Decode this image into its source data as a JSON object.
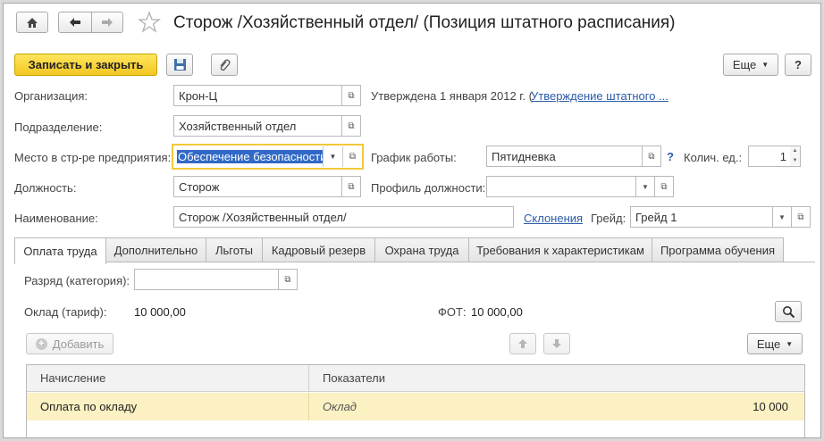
{
  "window": {
    "title": "Сторож /Хозяйственный отдел/ (Позиция штатного расписания)"
  },
  "toolbar": {
    "save_close_label": "Записать и закрыть",
    "more_label": "Еще",
    "help_label": "?"
  },
  "form": {
    "org_label": "Организация:",
    "org_value": "Крон-Ц",
    "approved_text": "Утверждена 1 января 2012 г. (",
    "approved_link": "Утверждение штатного ...",
    "dept_label": "Подразделение:",
    "dept_value": "Хозяйственный отдел",
    "place_label": "Место в стр-ре предприятия:",
    "place_value": "Обеспечение безопасности",
    "schedule_label": "График работы:",
    "schedule_value": "Пятидневка",
    "schedule_help": "?",
    "qty_label": "Колич. ед.:",
    "qty_value": "1",
    "position_label": "Должность:",
    "position_value": "Сторож",
    "profile_label": "Профиль должности:",
    "profile_value": "",
    "name_label": "Наименование:",
    "name_value": "Сторож /Хозяйственный отдел/",
    "declension_link": "Склонения",
    "grade_label": "Грейд:",
    "grade_value": "Грейд 1"
  },
  "tabs": [
    {
      "label": "Оплата труда"
    },
    {
      "label": "Дополнительно"
    },
    {
      "label": "Льготы"
    },
    {
      "label": "Кадровый резерв"
    },
    {
      "label": "Охрана труда"
    },
    {
      "label": "Требования к характеристикам"
    },
    {
      "label": "Программа обучения"
    }
  ],
  "payment": {
    "rank_label": "Разряд (категория):",
    "rank_value": "",
    "salary_label": "Оклад (тариф):",
    "salary_value": "10 000,00",
    "fot_label": "ФОТ:",
    "fot_value": "10 000,00",
    "add_label": "Добавить",
    "more_label": "Еще"
  },
  "grid": {
    "columns": [
      "Начисление",
      "Показатели"
    ],
    "rows": [
      {
        "accrual": "Оплата по окладу",
        "indicator": "Оклад",
        "amount": "10 000"
      }
    ]
  },
  "colors": {
    "accent_yellow": "#f3c623",
    "selection_blue": "#3169c6",
    "row_highlight": "#fbf1c2",
    "link_blue": "#2a5ca8"
  }
}
